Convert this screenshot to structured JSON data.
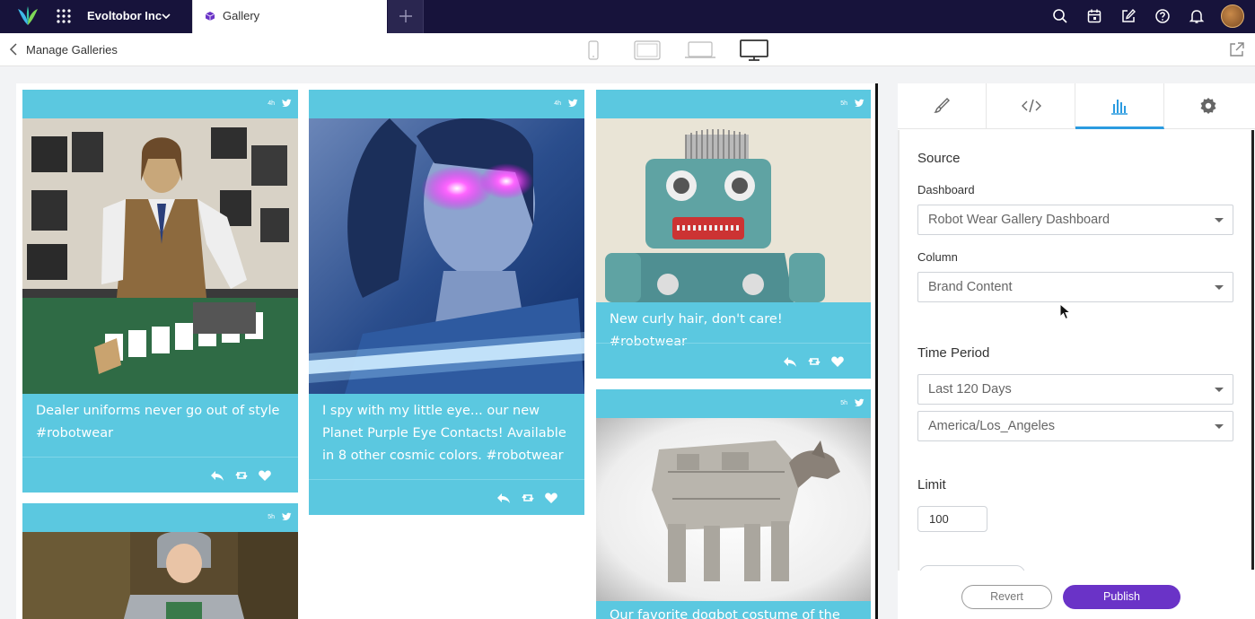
{
  "topbar": {
    "org_name": "Evoltobor Inc",
    "tab_label": "Gallery",
    "icons": [
      "logo-icon",
      "apps-grid-icon",
      "chevron-down-icon",
      "gallery-cube-icon",
      "plus-icon",
      "search-icon",
      "calendar-icon",
      "compose-icon",
      "help-icon",
      "bell-icon",
      "avatar"
    ]
  },
  "subbar": {
    "back_label": "Manage Galleries",
    "devices": [
      "phone-preview-icon",
      "tablet-preview-icon",
      "laptop-preview-icon",
      "desktop-preview-icon"
    ],
    "active_device": "desktop"
  },
  "gallery": {
    "accent": "#5bc8e0",
    "cards": [
      {
        "time": "4h",
        "text": "Dealer uniforms never go out of style #robotwear",
        "image": "robot casino dealer"
      },
      {
        "time": "4h",
        "text": "I spy with my little eye... our new Planet Purple Eye Contacts! Available in 8 other cosmic colors. #robotwear",
        "image": "woman with glowing purple eyes"
      },
      {
        "time": "5h",
        "text": "New curly hair, don't care! #robotwear",
        "image": "tin toy robot"
      },
      {
        "time": "5h",
        "text": "Our favorite dogbot costume of the",
        "image": "dog in walker costume"
      },
      {
        "time": "5h",
        "text": "",
        "image": "child in robot costume"
      }
    ]
  },
  "panel": {
    "tabs": [
      "brush-icon",
      "code-icon",
      "chart-bars-icon",
      "gear-icon"
    ],
    "active_tab": "chart-bars-icon",
    "source_title": "Source",
    "dashboard_label": "Dashboard",
    "dashboard_value": "Robot Wear Gallery Dashboard",
    "column_label": "Column",
    "column_value": "Brand Content",
    "time_title": "Time Period",
    "period_value": "Last 120 Days",
    "timezone_value": "America/Los_Angeles",
    "limit_title": "Limit",
    "limit_value": "100",
    "revert_label": "Revert",
    "publish_label": "Publish",
    "publish_color": "#6a33c7",
    "tab_accent": "#2b9be0"
  }
}
